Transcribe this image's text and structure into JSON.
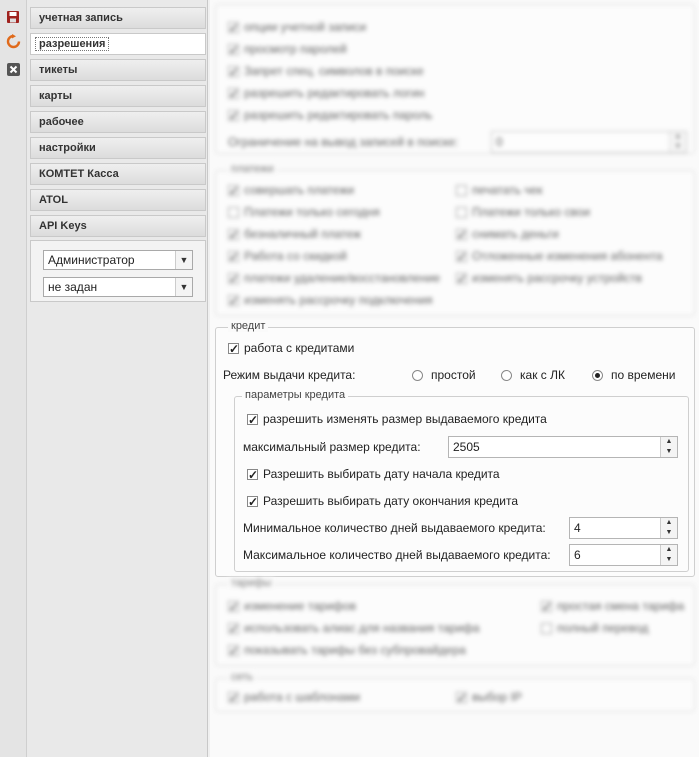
{
  "toolbar": {
    "icons": [
      "save-icon",
      "refresh-icon",
      "close-icon"
    ]
  },
  "nav": {
    "items": [
      {
        "label": "учетная запись"
      },
      {
        "label": "разрешения"
      },
      {
        "label": "тикеты"
      },
      {
        "label": "карты"
      },
      {
        "label": "рабочее"
      },
      {
        "label": "настройки"
      },
      {
        "label": "КОМТЕТ Касса"
      },
      {
        "label": "ATOL"
      },
      {
        "label": "API Keys"
      }
    ],
    "active_index": 1,
    "role_select": "Администратор",
    "second_select": "не задан"
  },
  "account": {
    "options": [
      "опции учетной записи",
      "просмотр паролей",
      "Запрет спец. символов в поиске",
      "разрешить редактировать логин",
      "разрешить редактировать пароль"
    ],
    "limit_label": "Ограничение на вывод записей в поиске:",
    "limit_value": "0"
  },
  "payments": {
    "legend": "платежи",
    "left": [
      "совершать платежи",
      "Платежи только сегодня",
      "безналичный платеж",
      "Работа со скидкой",
      "платежи удаление/восстановление",
      "изменять рассрочку подключения"
    ],
    "right": [
      "печатать чек",
      "Платежи только свои",
      "снимать деньги",
      "Отложенные изменения абонента",
      "изменять рассрочку устройств"
    ]
  },
  "credit": {
    "legend": "кредит",
    "work_with_credits": "работа с кредитами",
    "mode_label": "Режим выдачи кредита:",
    "modes": [
      "простой",
      "как с ЛК",
      "по времени"
    ],
    "selected_mode": "по времени",
    "params": {
      "legend": "параметры кредита",
      "allow_change_size": "разрешить изменять размер выдаваемого кредита",
      "max_size_label": "максимальный размер кредита:",
      "max_size_value": "2505",
      "allow_start_date": "Разрешить выбирать дату начала кредита",
      "allow_end_date": "Разрешить выбирать дату окончания кредита",
      "min_days_label": "Минимальное количество дней выдаваемого кредита:",
      "min_days_value": "4",
      "max_days_label": "Максимальное количество дней выдаваемого кредита:",
      "max_days_value": "6"
    }
  },
  "tariffs": {
    "legend": "тарифы",
    "left": [
      "изменение тарифов",
      "использовать алиас для названия тарифа",
      "показывать тарифы без субпровайдера"
    ],
    "right": [
      "простая смена тарифа",
      "полный перевод"
    ]
  },
  "network": {
    "legend": "сеть",
    "left": "работа с шаблонами",
    "right": "выбор IP"
  }
}
